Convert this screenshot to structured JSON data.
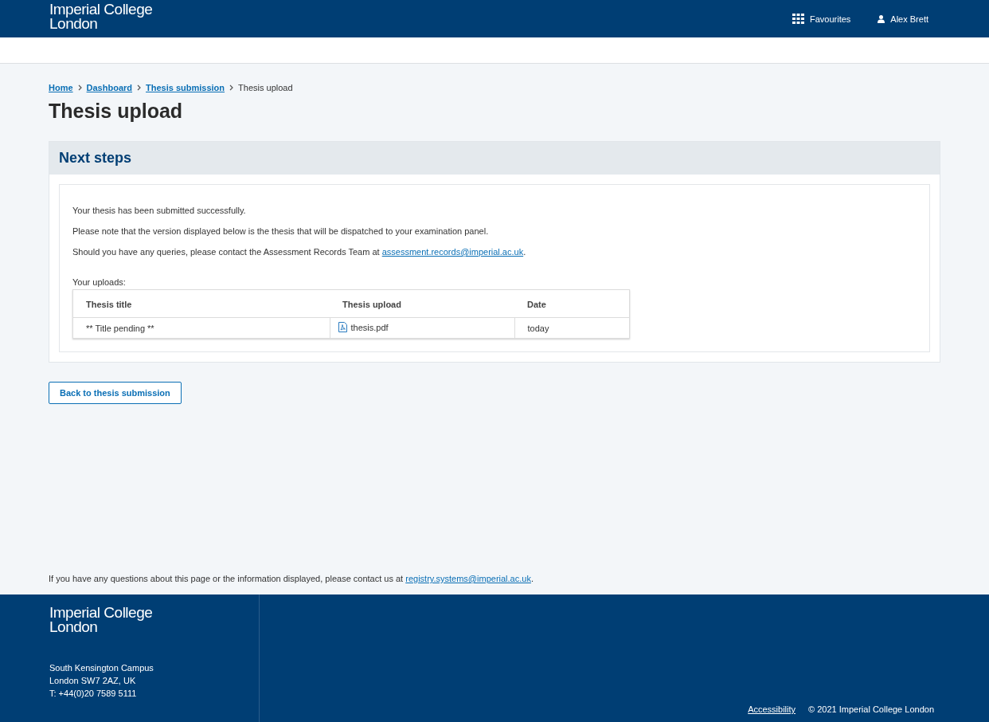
{
  "header": {
    "logo_lines": [
      "Imperial College",
      "London"
    ],
    "favourites": "Favourites",
    "user": "Alex Brett"
  },
  "breadcrumb": [
    {
      "label": "Home",
      "link": true
    },
    {
      "label": "Dashboard",
      "link": true
    },
    {
      "label": "Thesis submission",
      "link": true
    },
    {
      "label": "Thesis upload",
      "link": false
    }
  ],
  "title": "Thesis upload",
  "panel": {
    "heading": "Next steps",
    "messages": [
      "Your thesis has been submitted successfully.",
      "Please note that the version displayed below is the thesis that will be dispatched to your examination panel."
    ],
    "contact": {
      "before": "Should you have any queries, please contact the Assessment Records Team at ",
      "link": "assessment.records@imperial.ac.uk",
      "after": "."
    },
    "uploads_label": "Your uploads:",
    "table": {
      "columns": [
        "Thesis title",
        "Thesis upload",
        "Date"
      ],
      "rows": [
        {
          "title": "** Title pending  **",
          "file": "thesis.pdf",
          "date": "today"
        }
      ]
    }
  },
  "back_button": "Back to thesis submission",
  "page_contact": {
    "before": "If you have any questions about this page or the information displayed, please contact us at ",
    "link": "registry.systems@imperial.ac.uk",
    "after": "."
  },
  "footer": {
    "logo_lines": [
      "Imperial College",
      "London"
    ],
    "address": [
      "South Kensington Campus",
      "London SW7 2AZ, UK",
      "T: +44(0)20 7589 5111"
    ],
    "accessibility": "Accessibility",
    "copyright": "© 2021 Imperial College London"
  }
}
